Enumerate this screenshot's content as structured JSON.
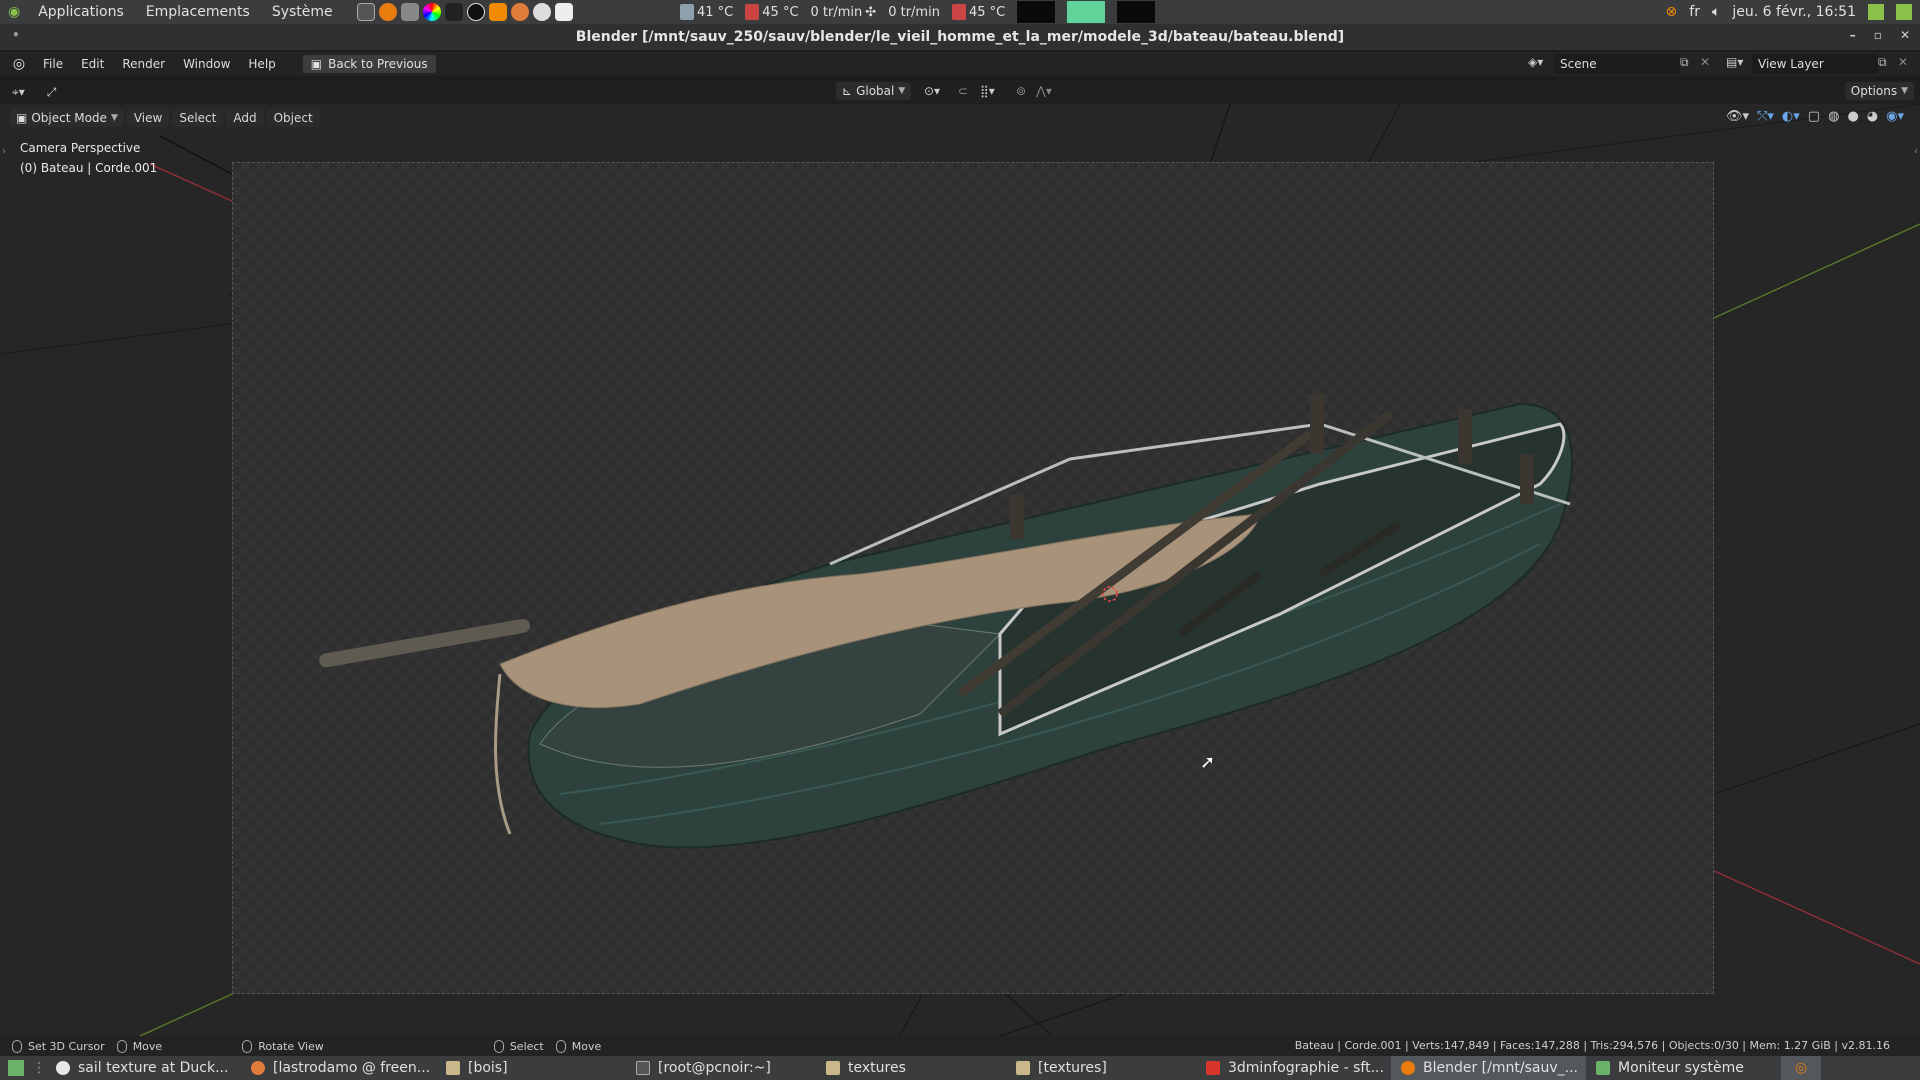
{
  "os_panel": {
    "menus": [
      "Applications",
      "Emplacements",
      "Système"
    ],
    "sensors": [
      {
        "label": "41 °C"
      },
      {
        "label": "45 °C"
      },
      {
        "label": "0 tr/min"
      },
      {
        "label": "0 tr/min"
      },
      {
        "label": "45 °C"
      }
    ],
    "lang": "fr",
    "datetime": "jeu. 6 févr., 16:51"
  },
  "window": {
    "title": "Blender [/mnt/sauv_250/sauv/blender/le_vieil_homme_et_la_mer/modele_3d/bateau/bateau.blend]"
  },
  "topbar": {
    "menus": [
      "File",
      "Edit",
      "Render",
      "Window",
      "Help"
    ],
    "back_button": "Back to Previous",
    "scene": "Scene",
    "view_layer": "View Layer"
  },
  "toolrow": {
    "orientation": "Global",
    "options": "Options"
  },
  "viewport_header": {
    "mode": "Object Mode",
    "menus": [
      "View",
      "Select",
      "Add",
      "Object"
    ]
  },
  "viewport": {
    "camera_label": "Camera Perspective",
    "object_label": "(0) Bateau | Corde.001"
  },
  "statusbar": {
    "hints": [
      "Set 3D Cursor",
      "Move",
      "Rotate View",
      "Select",
      "Move"
    ],
    "stats": "Bateau | Corde.001 | Verts:147,849 | Faces:147,288 | Tris:294,576 | Objects:0/30 | Mem: 1.27 GiB | v2.81.16"
  },
  "taskbar": {
    "tasks": [
      {
        "label": "sail texture at Duck...",
        "color": "#e8e8e8"
      },
      {
        "label": "[lastrodamo @ freen...",
        "color": "#e07b39"
      },
      {
        "label": "[bois]",
        "color": "#c9b98a"
      },
      {
        "label": "[root@pcnoir:~]",
        "color": "#555555"
      },
      {
        "label": "textures",
        "color": "#c9b98a"
      },
      {
        "label": "[textures]",
        "color": "#c9b98a"
      },
      {
        "label": "3dminfographie - sft...",
        "color": "#d9342b"
      },
      {
        "label": "Blender [/mnt/sauv_...",
        "color": "#e87d0d"
      },
      {
        "label": "Moniteur système",
        "color": "#6bb26b"
      }
    ]
  }
}
